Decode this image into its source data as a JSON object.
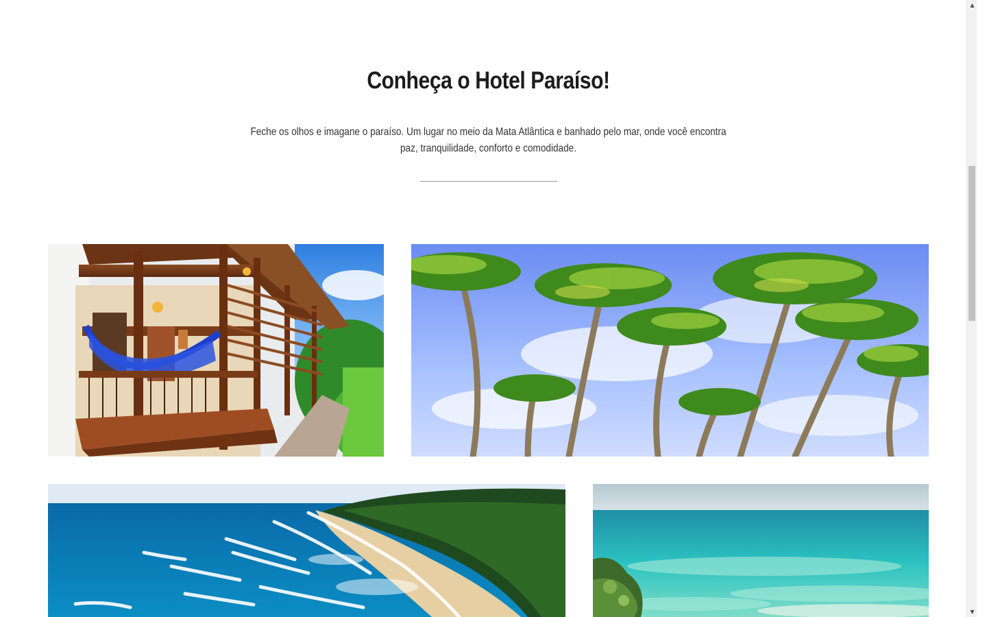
{
  "section": {
    "title": "Conheça o Hotel Paraíso!",
    "intro": "Feche os olhos e imagane o paraíso. Um lugar no meio da Mata Atlântica e banhado pelo mar, onde você encontra paz, tranquilidade, conforto e comodidade."
  },
  "gallery": [
    {
      "name": "hotel-veranda-hammocks-photo"
    },
    {
      "name": "palm-trees-sky-photo"
    },
    {
      "name": "beach-coastline-photo"
    },
    {
      "name": "turquoise-sea-photo"
    }
  ],
  "colors": {
    "heading": "#1c1c1c",
    "text": "#333333",
    "divider": "#9a9a9a",
    "scrollbar_track": "#f1f1f1",
    "scrollbar_thumb": "#c1c1c1"
  },
  "scrollbar": {
    "up_icon": "triangle-up-icon",
    "down_icon": "triangle-down-icon"
  }
}
